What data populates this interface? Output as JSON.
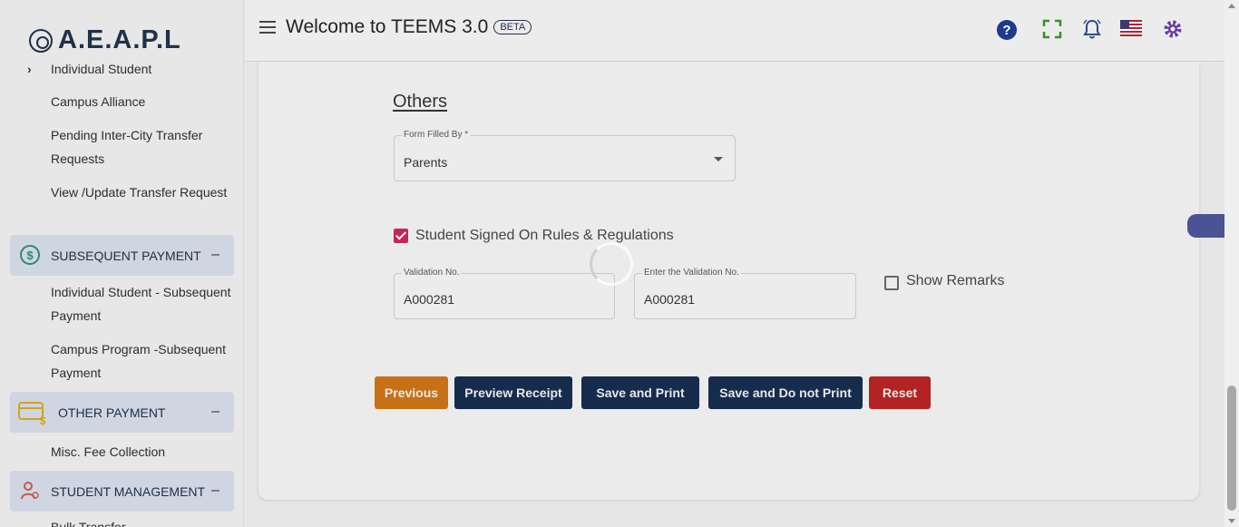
{
  "brand": {
    "logo_text": "A.E.A.P.L"
  },
  "header": {
    "title": "Welcome to TEEMS 3.0",
    "badge": "BETA",
    "icons": [
      "help-icon",
      "fullscreen-icon",
      "notification-bell-icon",
      "us-flag-icon",
      "settings-gear-icon"
    ]
  },
  "sidebar": {
    "items_top": [
      "Individual Student",
      "Campus Alliance",
      "Pending Inter-City Transfer Requests",
      "View /Update Transfer Request"
    ],
    "sections": [
      {
        "label": "SUBSEQUENT PAYMENT",
        "icon": "dollar-circle-icon",
        "toggle": "–"
      },
      {
        "label": "OTHER PAYMENT",
        "icon": "card-dollar-icon",
        "toggle": "–"
      },
      {
        "label": "STUDENT MANAGEMENT",
        "icon": "student-management-icon",
        "toggle": "–"
      }
    ],
    "subsequent_items": [
      "Individual Student - Subsequent Payment",
      "Campus Program -Subsequent Payment"
    ],
    "other_items": [
      "Misc. Fee Collection"
    ],
    "student_mgmt_items": [
      "Bulk Transfer"
    ]
  },
  "form": {
    "section_title": "Others",
    "form_filled_by": {
      "label": "Form Filled By *",
      "value": "Parents"
    },
    "signed_rules": {
      "label": "Student Signed On Rules & Regulations",
      "checked": true
    },
    "validation_no": {
      "label": "Validation No.",
      "value": "A000281"
    },
    "enter_validation_no": {
      "label": "Enter the Validation No.",
      "value": "A000281"
    },
    "show_remarks": {
      "label": "Show Remarks",
      "checked": false
    }
  },
  "buttons": {
    "previous": "Previous",
    "preview_receipt": "Preview Receipt",
    "save_print": "Save and Print",
    "save_no_print": "Save and Do not Print",
    "reset": "Reset"
  },
  "colors": {
    "brand_navy": "#162c4d",
    "previous_orange": "#c77116",
    "reset_red": "#b32323",
    "checkbox_pink": "#c4265c"
  }
}
